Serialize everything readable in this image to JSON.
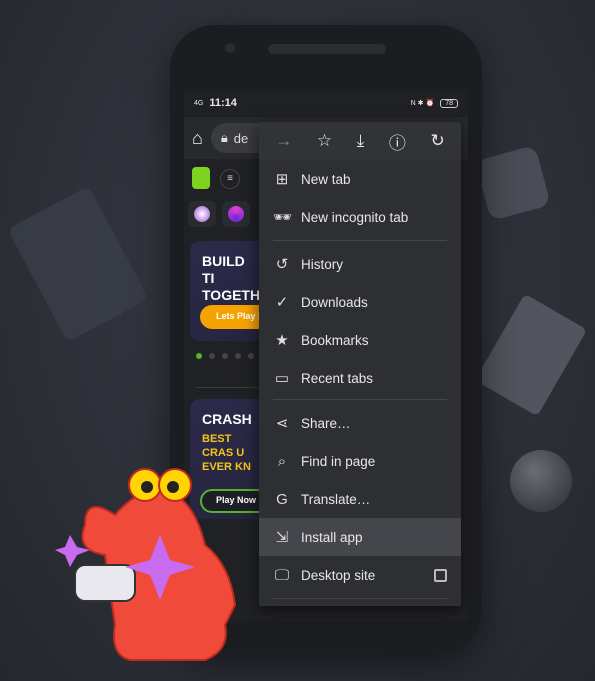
{
  "status_bar": {
    "time": "11:14",
    "network_left": "4G",
    "battery": "78"
  },
  "browser": {
    "url_partial": "de"
  },
  "site": {
    "banner1": {
      "title": "BUILD TI TOGETH",
      "button": "Lets Play N"
    },
    "banner2": {
      "title": "CRASH",
      "subtitle": "BEST CRAS U EVER KN",
      "button": "Play Now"
    }
  },
  "menu": {
    "toolbar": [
      {
        "icon": "forward-icon"
      },
      {
        "icon": "bookmark-star-icon"
      },
      {
        "icon": "download-icon"
      },
      {
        "icon": "info-icon"
      },
      {
        "icon": "refresh-icon"
      }
    ],
    "items": [
      {
        "label": "New tab",
        "icon": "new-tab-icon"
      },
      {
        "label": "New incognito tab",
        "icon": "incognito-icon"
      },
      {
        "label": "History",
        "icon": "history-icon"
      },
      {
        "label": "Downloads",
        "icon": "downloads-icon"
      },
      {
        "label": "Bookmarks",
        "icon": "star-icon"
      },
      {
        "label": "Recent tabs",
        "icon": "devices-icon"
      },
      {
        "label": "Share…",
        "icon": "share-icon"
      },
      {
        "label": "Find in page",
        "icon": "find-icon"
      },
      {
        "label": "Translate…",
        "icon": "translate-icon"
      },
      {
        "label": "Install app",
        "icon": "install-icon",
        "highlighted": true
      },
      {
        "label": "Desktop site",
        "icon": "desktop-icon",
        "checked": false
      }
    ]
  },
  "colors": {
    "highlight": "#45464b",
    "brand_green": "#7ed321",
    "cta_orange": "#f5a300",
    "mascot_red": "#f04a3a"
  }
}
